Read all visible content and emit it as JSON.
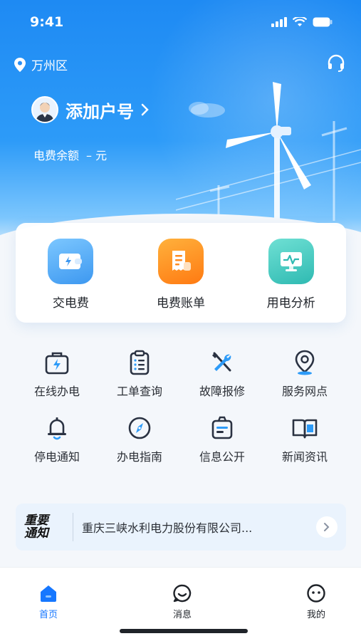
{
  "status_bar": {
    "time": "9:41"
  },
  "header": {
    "location": "万州区",
    "account_label": "添加户号",
    "balance_label": "电费余额",
    "balance_value": "– 元"
  },
  "quick_actions": [
    {
      "label": "交电费",
      "icon": "wallet-bolt-icon",
      "color": "#4aa8f5"
    },
    {
      "label": "电费账单",
      "icon": "bill-icon",
      "color": "#ff8a1e"
    },
    {
      "label": "用电分析",
      "icon": "monitor-pulse-icon",
      "color": "#3fcbc2"
    }
  ],
  "services": [
    {
      "label": "在线办电",
      "icon": "briefcase-bolt-icon"
    },
    {
      "label": "工单查询",
      "icon": "clipboard-list-icon"
    },
    {
      "label": "故障报修",
      "icon": "tools-icon"
    },
    {
      "label": "服务网点",
      "icon": "map-pin-icon"
    },
    {
      "label": "停电通知",
      "icon": "bell-icon"
    },
    {
      "label": "办电指南",
      "icon": "compass-icon"
    },
    {
      "label": "信息公开",
      "icon": "info-card-icon"
    },
    {
      "label": "新闻资讯",
      "icon": "open-book-icon"
    }
  ],
  "notice": {
    "tag_line1": "重要",
    "tag_line2": "通知",
    "text": "重庆三峡水利电力股份有限公司..."
  },
  "tabs": [
    {
      "label": "首页",
      "icon": "home-icon",
      "active": true
    },
    {
      "label": "消息",
      "icon": "message-smile-icon",
      "active": false
    },
    {
      "label": "我的",
      "icon": "profile-face-icon",
      "active": false
    }
  ],
  "colors": {
    "brand": "#1677ff",
    "accent_blue": "#2d9bf8",
    "icon_dark": "#2a3242"
  }
}
